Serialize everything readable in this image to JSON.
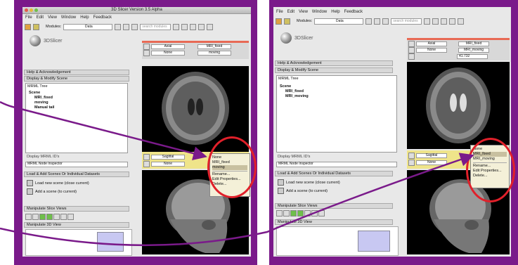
{
  "left": {
    "window_title": "3D Slicer Version 3.5 Alpha",
    "menu": [
      "File",
      "Edit",
      "View",
      "Window",
      "Help",
      "Feedback"
    ],
    "modules_label": "Modules:",
    "module_value": "Data",
    "search_placeholder": "search modules",
    "logo_text": "3DSlicer",
    "sections": {
      "help": "Help & Acknowledgement",
      "display": "Display & Modify Scene",
      "load": "Load & Add Scenes Or Individual Datasets",
      "slice_views": "Manipulate Slice Views",
      "views_3d": "Manipulate 3D View"
    },
    "mrml_tree_label": "MRML Tree",
    "tree": [
      "Scene",
      "MRI_fixed",
      "moving",
      "Manual tail"
    ],
    "display_ids_label": "Display MRML ID's",
    "node_inspector_label": "MRML Node Inspector",
    "load_label": "Load new scene (close current)",
    "add_label": "Add a scene (to current)",
    "top_ctrl": {
      "orient": "Axial",
      "vol": "MRI_fixed",
      "none": "None",
      "moving": "moving"
    },
    "bottom_ctrl": {
      "orient": "Sagittal",
      "none": "None"
    },
    "menu_items": [
      "None",
      "MRI_fixed",
      "moving",
      "Rename...",
      "Edit Properties...",
      "Delete..."
    ]
  },
  "right": {
    "menu": [
      "File",
      "Edit",
      "View",
      "Window",
      "Help",
      "Feedback"
    ],
    "modules_label": "Modules:",
    "module_value": "Data",
    "search_placeholder": "search modules",
    "logo_text": "3DSlicer",
    "sections": {
      "help": "Help & Acknowledgement",
      "display": "Display & Modify Scene",
      "load": "Load & Add Scenes Or Individual Datasets",
      "slice_views": "Manipulate Slice Views",
      "views_3d": "Manipulate 3D View"
    },
    "mrml_tree_label": "MRML Tree",
    "tree": [
      "Scene",
      "MRI_fixed",
      "MRI_moving"
    ],
    "display_ids_label": "Display MRML ID's",
    "node_inspector_label": "MRML Node Inspector",
    "load_label": "Load new scene (close current)",
    "add_label": "Add a scene (to current)",
    "top_ctrl": {
      "orient": "Axial",
      "vol": "MRI_fixed",
      "none": "None",
      "moving": "MRI_moving",
      "value": "41.732"
    },
    "bottom_ctrl": {
      "orient": "Sagittal",
      "none": "None"
    },
    "menu_items": [
      "None",
      "MRI_fixed",
      "MRI_moving",
      "Rename...",
      "Edit Properties...",
      "Delete..."
    ]
  },
  "colors": {
    "frame": "#7a1a8a",
    "highlight_oval": "#e0202a",
    "arrow": "#7a1a8a"
  }
}
